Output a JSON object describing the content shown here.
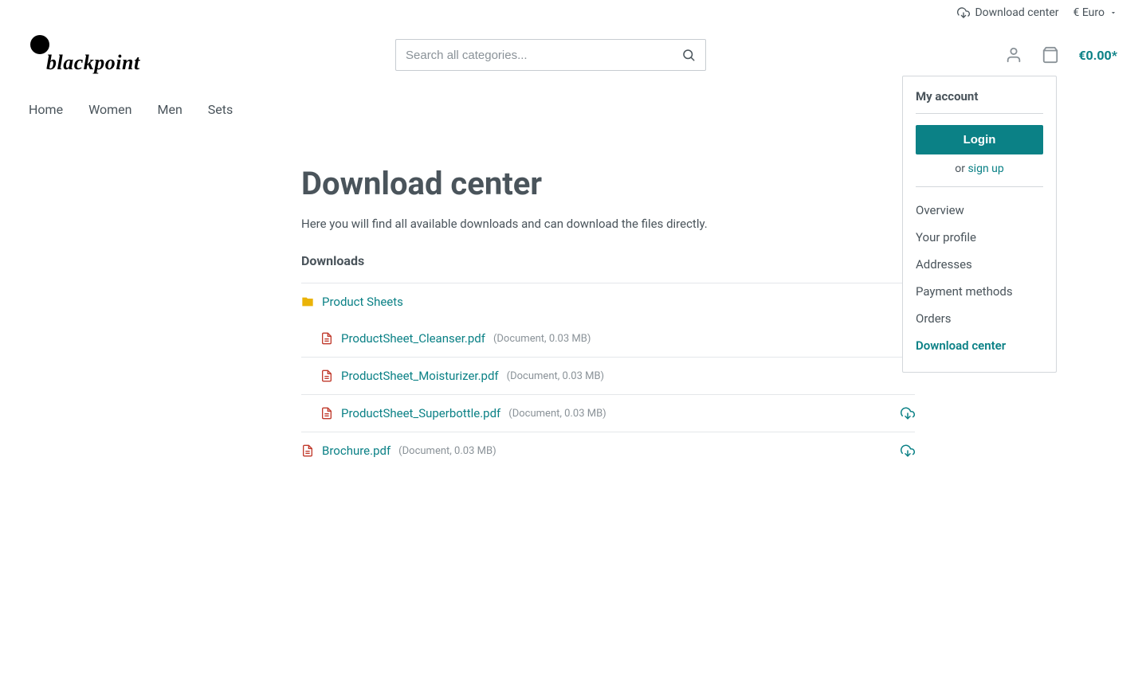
{
  "top": {
    "download_center": "Download center",
    "currency": "€ Euro"
  },
  "logo": {
    "text": "blackpoint"
  },
  "search": {
    "placeholder": "Search all categories..."
  },
  "cart": {
    "total": "€0.00*"
  },
  "nav": {
    "items": [
      "Home",
      "Women",
      "Men",
      "Sets"
    ]
  },
  "page": {
    "title": "Download center",
    "description": "Here you will find all available downloads and can download the files directly.",
    "section": "Downloads"
  },
  "folder": {
    "name": "Product Sheets"
  },
  "files": {
    "in_folder": [
      {
        "name": "ProductSheet_Cleanser.pdf",
        "meta": "(Document, 0.03 MB)"
      },
      {
        "name": "ProductSheet_Moisturizer.pdf",
        "meta": "(Document, 0.03 MB)"
      },
      {
        "name": "ProductSheet_Superbottle.pdf",
        "meta": "(Document, 0.03 MB)"
      }
    ],
    "root": [
      {
        "name": "Brochure.pdf",
        "meta": "(Document, 0.03 MB)"
      }
    ]
  },
  "account": {
    "title": "My account",
    "login": "Login",
    "or": "or ",
    "signup": "sign up",
    "links": [
      {
        "label": "Overview",
        "active": false
      },
      {
        "label": "Your profile",
        "active": false
      },
      {
        "label": "Addresses",
        "active": false
      },
      {
        "label": "Payment methods",
        "active": false
      },
      {
        "label": "Orders",
        "active": false
      },
      {
        "label": "Download center",
        "active": true
      }
    ]
  }
}
